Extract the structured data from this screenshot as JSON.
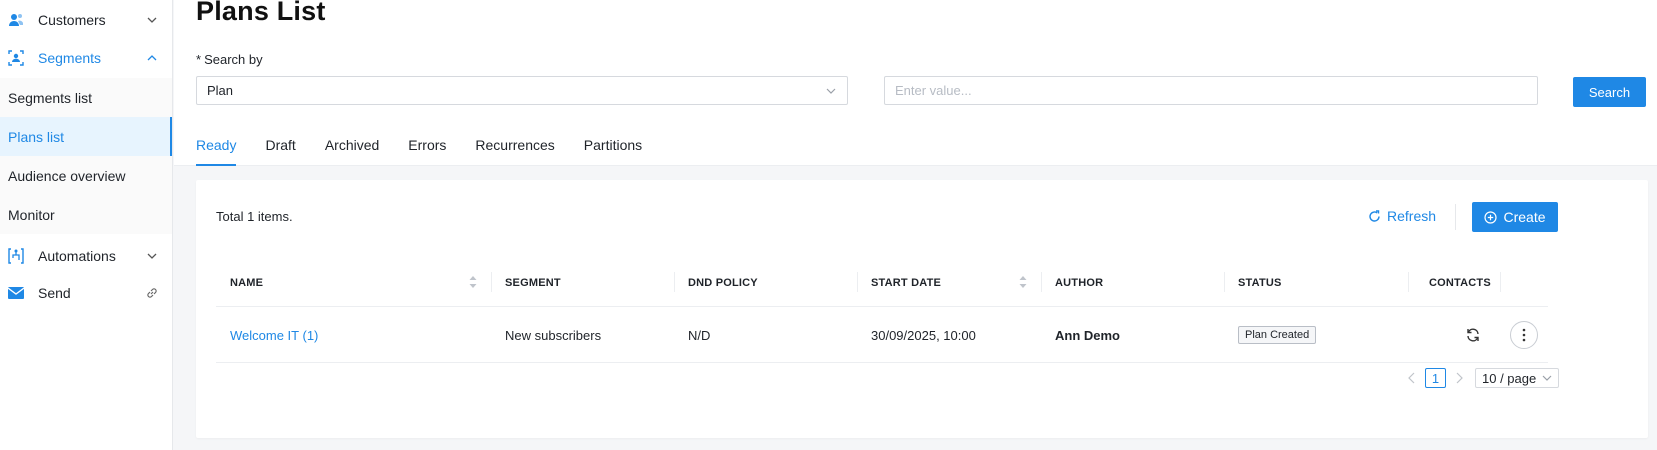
{
  "sidebar": {
    "customers": {
      "label": "Customers",
      "icon": "customers-icon"
    },
    "segments": {
      "label": "Segments",
      "icon": "segments-icon",
      "items": [
        {
          "label": "Segments list"
        },
        {
          "label": "Plans list"
        },
        {
          "label": "Audience overview"
        },
        {
          "label": "Monitor"
        }
      ]
    },
    "automations": {
      "label": "Automations",
      "icon": "automations-icon"
    },
    "send": {
      "label": "Send",
      "icon": "mail-icon"
    }
  },
  "page": {
    "title": "Plans List",
    "search_label": "Search by",
    "required_mark": "*",
    "search_field": "Plan",
    "value_placeholder": "Enter value...",
    "search_button": "Search"
  },
  "tabs": [
    {
      "label": "Ready"
    },
    {
      "label": "Draft"
    },
    {
      "label": "Archived"
    },
    {
      "label": "Errors"
    },
    {
      "label": "Recurrences"
    },
    {
      "label": "Partitions"
    }
  ],
  "table": {
    "total": "Total 1 items.",
    "refresh_label": "Refresh",
    "create_label": "Create",
    "columns": {
      "name": "NAME",
      "segment": "SEGMENT",
      "dnd": "DND POLICY",
      "start": "START DATE",
      "author": "AUTHOR",
      "status": "STATUS",
      "contacts": "CONTACTS"
    },
    "rows": [
      {
        "name": "Welcome IT (1)",
        "segment": "New subscribers",
        "dnd": "N/D",
        "start": "30/09/2025, 10:00",
        "author": "Ann Demo",
        "status": "Plan Created"
      }
    ]
  },
  "pagination": {
    "current_page": "1",
    "page_size": "10 / page"
  },
  "colors": {
    "accent": "#1f88e5",
    "selected_bg": "#e7f4fe"
  }
}
